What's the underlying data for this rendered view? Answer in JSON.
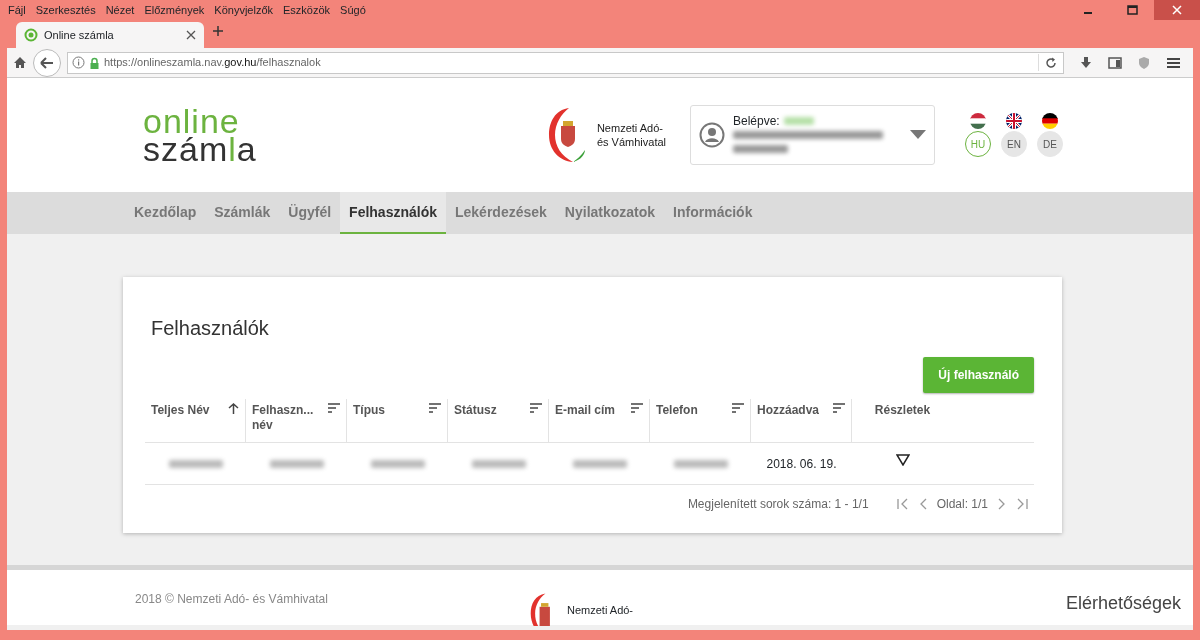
{
  "menu": [
    "Fájl",
    "Szerkesztés",
    "Nézet",
    "Előzmények",
    "Könyvjelzők",
    "Eszközök",
    "Súgó"
  ],
  "tabs": [
    {
      "label": "Online számla",
      "selected": true
    }
  ],
  "address": {
    "prefix": "https://onlineszamla.nav.",
    "domain": "gov.hu",
    "path": "/felhasznalok"
  },
  "logo": {
    "lines": [
      [
        {
          "text": "online",
          "accent": true
        }
      ],
      [
        {
          "text": "szám",
          "accent": false
        },
        {
          "text": "l",
          "accent": true
        },
        {
          "text": "a",
          "accent": false
        }
      ]
    ]
  },
  "agency": {
    "line1": "Nemzeti Adó-",
    "line2": "és Vámhivatal"
  },
  "user": {
    "label": "Belépve:"
  },
  "languages": [
    {
      "code": "HU",
      "kind": "hungary",
      "selected": true
    },
    {
      "code": "EN",
      "kind": "britain",
      "selected": false
    },
    {
      "code": "DE",
      "kind": "germany",
      "selected": false
    }
  ],
  "nav": [
    {
      "label": "Kezdőlap",
      "selected": false
    },
    {
      "label": "Számlák",
      "selected": false
    },
    {
      "label": "Ügyfél",
      "selected": false
    },
    {
      "label": "Felhasználók",
      "selected": true
    },
    {
      "label": "Lekérdezések",
      "selected": false
    },
    {
      "label": "Nyilatkozatok",
      "selected": false
    },
    {
      "label": "Információk",
      "selected": false
    }
  ],
  "page_title": "Felhasználók",
  "new_button": "Új felhasználó",
  "table": {
    "columns": [
      {
        "label": "Teljes Név",
        "kind": "ascending"
      },
      {
        "label": "Felhaszn... név",
        "kind": "sortable"
      },
      {
        "label": "Típus",
        "kind": "sortable"
      },
      {
        "label": "Státusz",
        "kind": "sortable"
      },
      {
        "label": "E-mail cím",
        "kind": "sortable"
      },
      {
        "label": "Telefon",
        "kind": "sortable"
      },
      {
        "label": "Hozzáadva",
        "kind": "sortable"
      },
      {
        "label": "Részletek",
        "kind": "plain"
      }
    ],
    "rows": [
      {
        "cells": [
          {
            "kind": "blurred"
          },
          {
            "kind": "blurred"
          },
          {
            "kind": "blurred"
          },
          {
            "kind": "blurred"
          },
          {
            "kind": "blurred"
          },
          {
            "kind": "blurred"
          },
          {
            "kind": "text",
            "text": "2018. 06. 19."
          },
          {
            "kind": "expand"
          }
        ]
      }
    ]
  },
  "pagination": {
    "rows_text": "Megjelenített sorok száma: 1 - 1/1",
    "page_text": "Oldal: 1/1"
  },
  "footer": {
    "copyright": "2018 © Nemzeti Adó- és Vámhivatal",
    "agency_line1": "Nemzeti Adó-",
    "contact": "Elérhetőségek"
  }
}
